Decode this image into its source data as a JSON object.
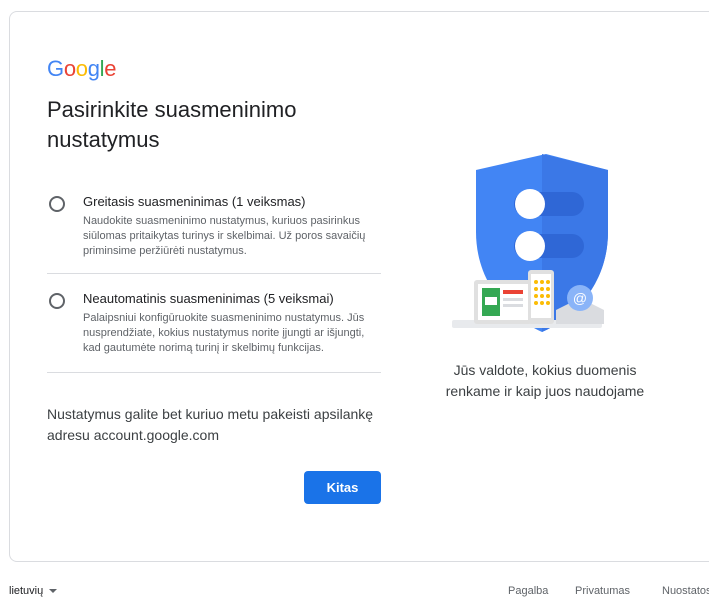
{
  "logo": {
    "letters": [
      "G",
      "o",
      "o",
      "g",
      "l",
      "e"
    ],
    "colors": [
      "#4285F4",
      "#EA4335",
      "#FBBC05",
      "#4285F4",
      "#34A853",
      "#EA4335"
    ]
  },
  "title": "Pasirinkite suasmeninimo nustatymus",
  "options": [
    {
      "title": "Greitasis suasmeninimas (1 veiksmas)",
      "description": "Naudokite suasmeninimo nustatymus, kuriuos pasirinkus siūlomas pritaikytas turinys ir skelbimai. Už poros savaičių priminsime peržiūrėti nustatymus.",
      "selected": false
    },
    {
      "title": "Neautomatinis suasmeninimas (5 veiksmai)",
      "description": "Palaipsniui konfigūruokite suasmeninimo nustatymus. Jūs nusprendžiate, kokius nustatymus norite įjungti ar išjungti, kad gautumėte norimą turinį ir skelbimų funkcijas.",
      "selected": false
    }
  ],
  "footnote": "Nustatymus galite bet kuriuo metu pakeisti apsilankę adresu account.google.com",
  "next_button": "Kitas",
  "illustration": {
    "icon": "privacy-shield-icon",
    "caption": "Jūs valdote, kokius duomenis renkame ir kaip juos naudojame"
  },
  "footer": {
    "language": "lietuvių",
    "links": [
      "Pagalba",
      "Privatumas",
      "Nuostatos"
    ]
  },
  "colors": {
    "accent": "#1a73e8",
    "shield": "#4285F4"
  }
}
